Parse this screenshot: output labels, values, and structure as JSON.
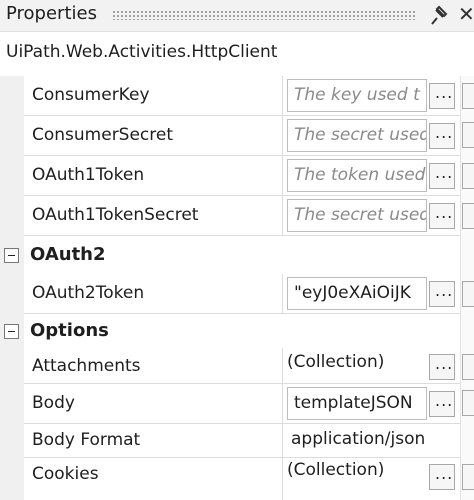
{
  "panel": {
    "title": "Properties",
    "close_glyph": "✕",
    "pin_icon": "pushpin-icon"
  },
  "type_name": "UiPath.Web.Activities.HttpClient",
  "rows_top": [
    {
      "name": "ConsumerKey",
      "placeholder": "The key used t",
      "has_button": true
    },
    {
      "name": "ConsumerSecret",
      "placeholder": "The secret used",
      "has_button": true
    },
    {
      "name": "OAuth1Token",
      "placeholder": "The token used",
      "has_button": true
    },
    {
      "name": "OAuth1TokenSecret",
      "placeholder": "The secret used",
      "has_button": true
    }
  ],
  "oauth2": {
    "label": "OAuth2",
    "rows": [
      {
        "name": "OAuth2Token",
        "value": "\"eyJ0eXAiOiJK",
        "has_button": true
      }
    ]
  },
  "options": {
    "label": "Options",
    "rows": [
      {
        "name": "Attachments",
        "value": "(Collection)",
        "kind": "plain",
        "has_button": true
      },
      {
        "name": "Body",
        "value": "templateJSON",
        "kind": "textbox",
        "has_button": true
      },
      {
        "name": "Body Format",
        "value": "application/json",
        "kind": "plain",
        "has_button": false
      },
      {
        "name": "Cookies",
        "value": "(Collection)",
        "kind": "plain",
        "has_button": true
      }
    ]
  },
  "ellipsis_label": "..."
}
